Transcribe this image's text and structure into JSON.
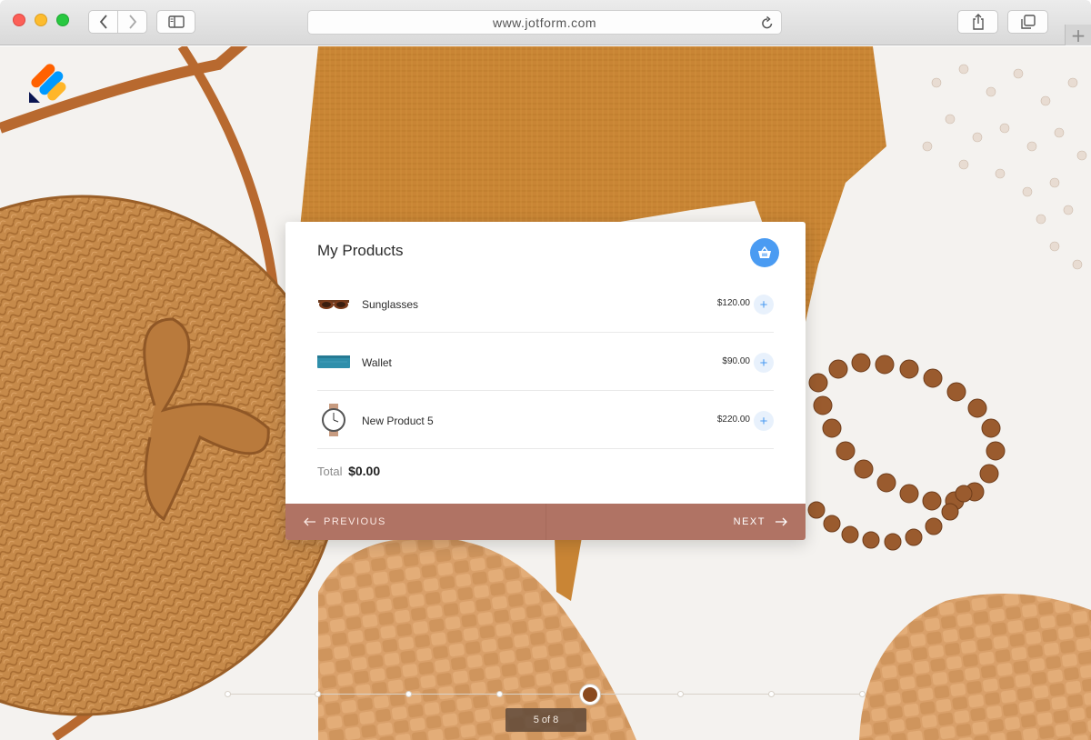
{
  "browser": {
    "url": "www.jotform.com",
    "new_tab_label": "+"
  },
  "card": {
    "title": "My Products",
    "products": [
      {
        "name": "Sunglasses",
        "price": "$120.00",
        "add_label": "+"
      },
      {
        "name": "Wallet",
        "price": "$90.00",
        "add_label": "+"
      },
      {
        "name": "New Product 5",
        "price": "$220.00",
        "add_label": "+"
      }
    ],
    "total_label": "Total",
    "total_value": "$0.00",
    "previous_label": "PREVIOUS",
    "next_label": "NEXT"
  },
  "progress": {
    "current": 5,
    "total": 8,
    "counter_text": "5 of 8"
  },
  "colors": {
    "accent_blue": "#4a9bf2",
    "footer_brown": "#b07364",
    "current_step": "#8b4a1f"
  },
  "icons": {
    "basket": "basket-icon",
    "share": "share-icon",
    "tabs": "tabs-icon",
    "reload": "reload-icon",
    "sidebar": "sidebar-icon"
  }
}
